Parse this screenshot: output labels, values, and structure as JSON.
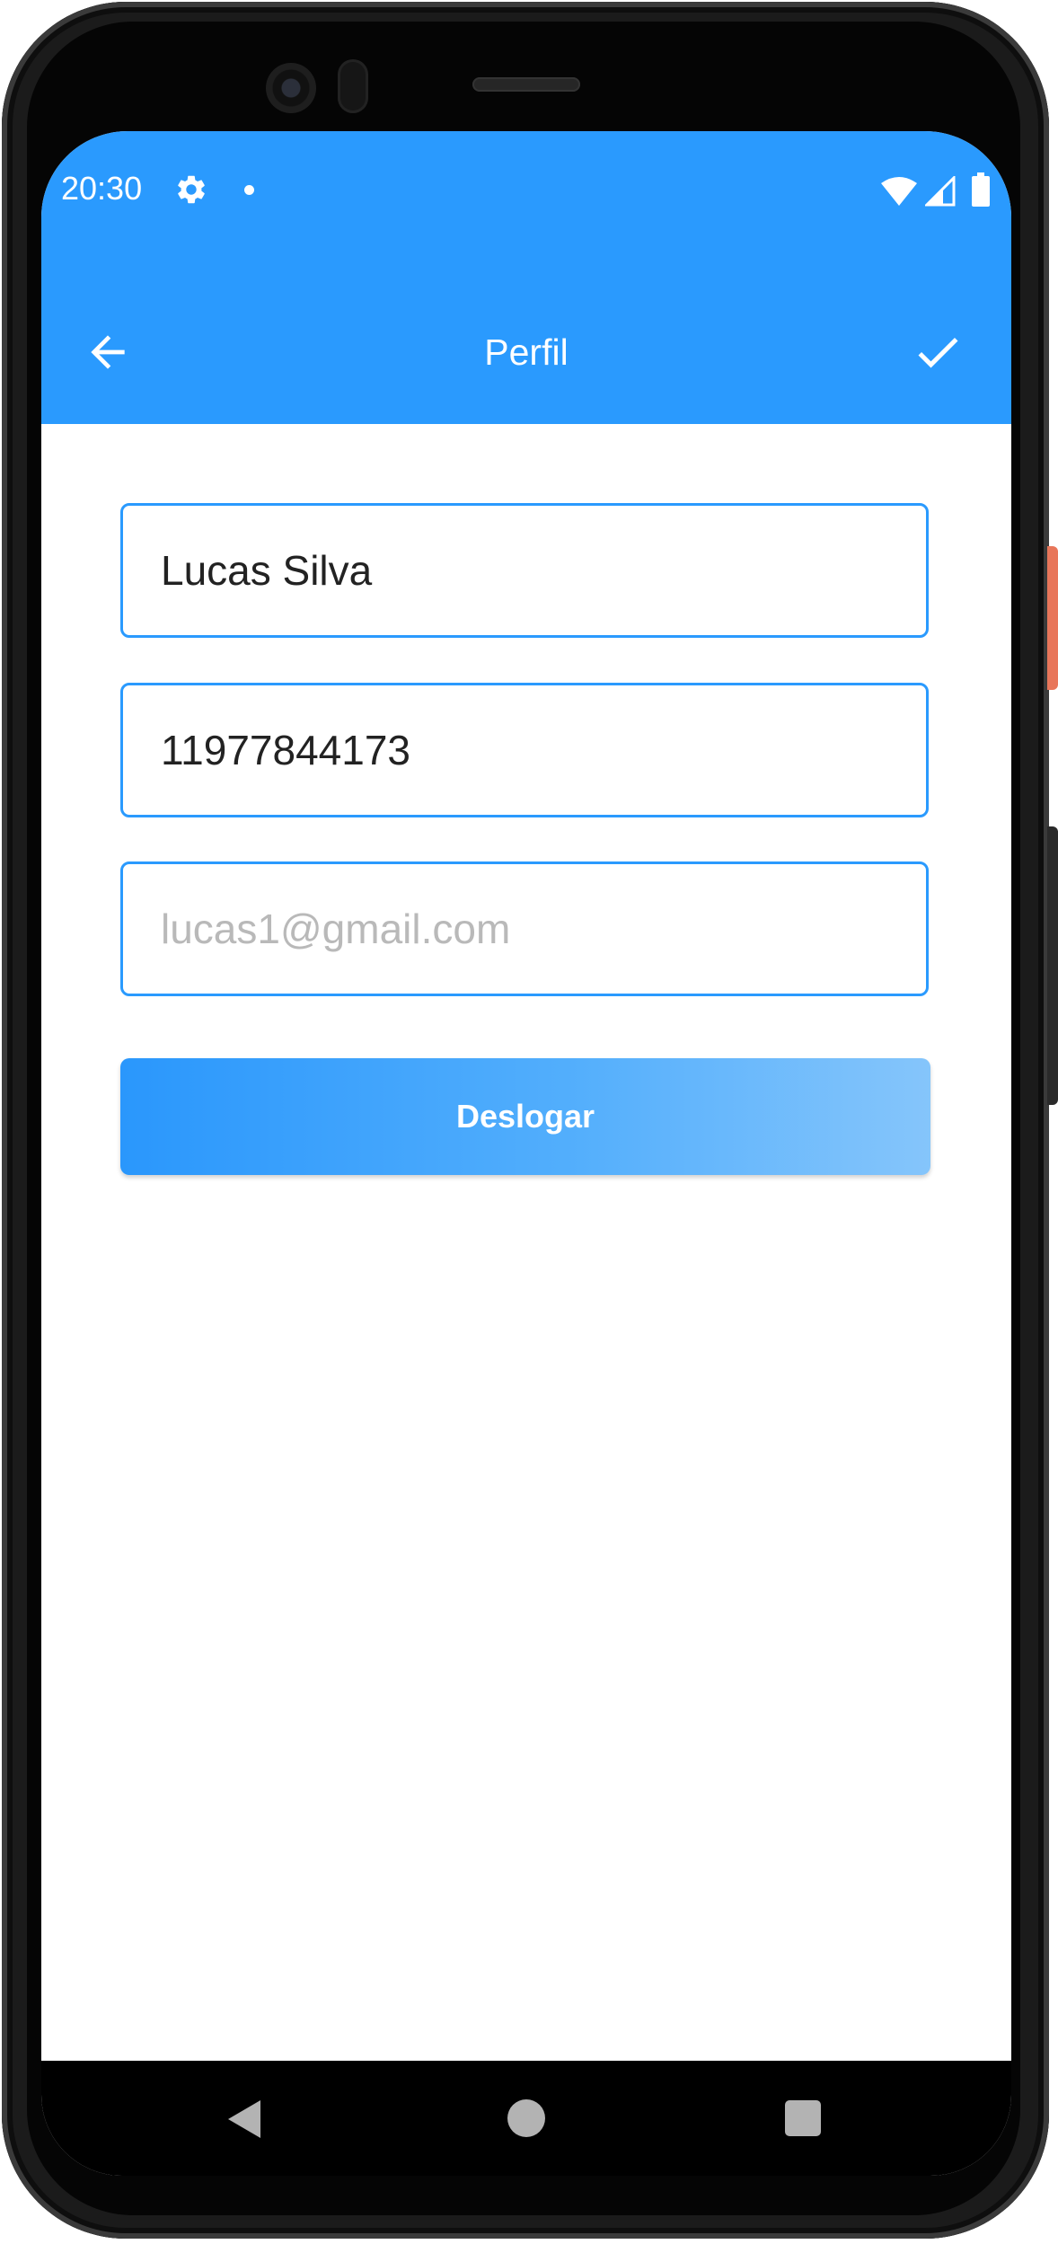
{
  "status_bar": {
    "time": "20:30",
    "icons": [
      "gear-icon",
      "dot-icon",
      "wifi-icon",
      "cell-signal-icon",
      "battery-icon"
    ]
  },
  "app_bar": {
    "title": "Perfil",
    "back_icon": "arrow-left-icon",
    "confirm_icon": "check-icon",
    "background_color": "#2a9afe"
  },
  "form": {
    "name_value": "Lucas Silva",
    "phone_value": "11977844173",
    "email_value": "",
    "email_placeholder": "lucas1@gmail.com"
  },
  "logout_button": {
    "label": "Deslogar"
  },
  "nav_bar": {
    "icons": [
      "nav-back-icon",
      "nav-home-icon",
      "nav-recents-icon"
    ]
  },
  "colors": {
    "accent": "#2a9afe",
    "field_border": "#2a9afe"
  }
}
